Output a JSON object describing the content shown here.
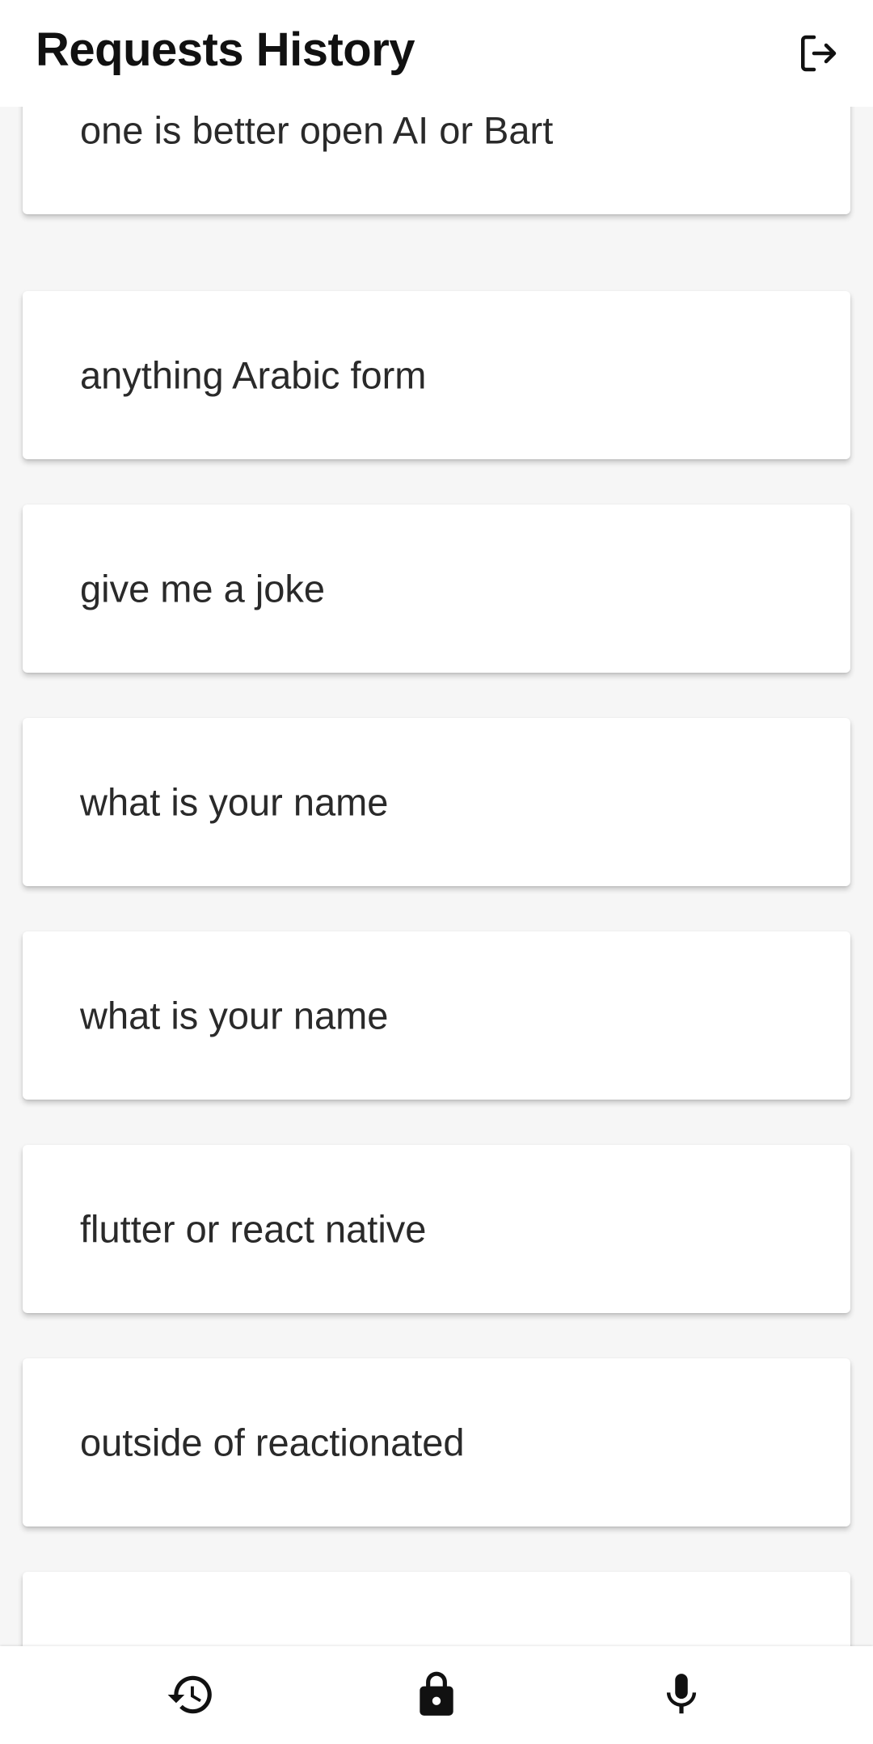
{
  "header": {
    "title": "Requests History",
    "logout_icon": "logout-icon"
  },
  "requests": [
    "one is better open AI or Bart",
    "anything Arabic form",
    "give me a joke",
    "what is your name",
    "what is your name",
    "flutter or react native",
    "outside of reactionated",
    "",
    "",
    ""
  ],
  "bottom_nav": {
    "items": [
      {
        "icon": "history-icon"
      },
      {
        "icon": "lock-icon"
      },
      {
        "icon": "microphone-icon"
      }
    ]
  },
  "colors": {
    "background": "#f6f6f6",
    "surface": "#ffffff",
    "text": "#2a2a2a",
    "title": "#111111"
  }
}
